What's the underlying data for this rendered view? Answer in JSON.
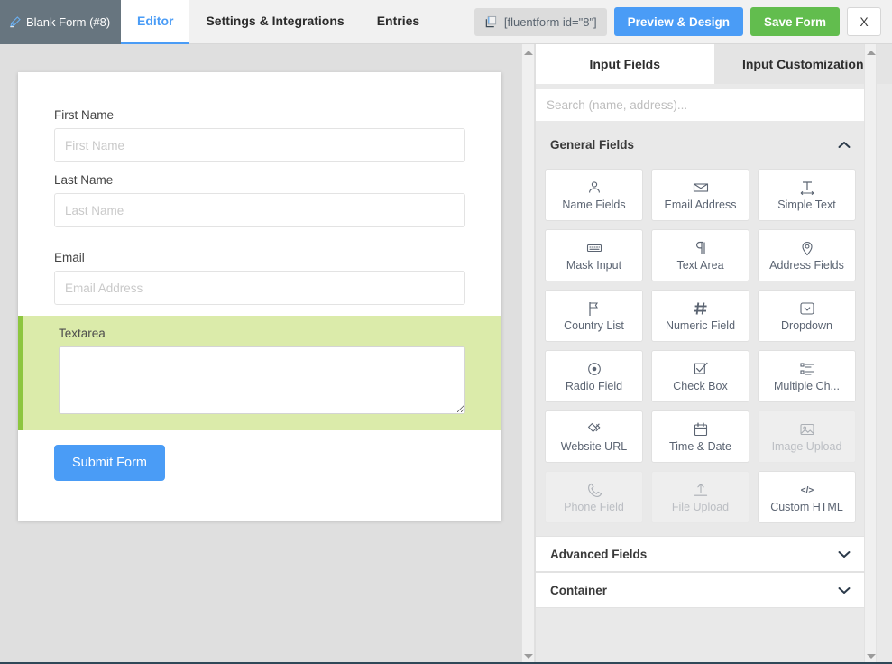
{
  "header": {
    "form_title": "Blank Form (#8)",
    "pencil_icon": "pencil-icon",
    "tabs": [
      {
        "label": "Editor",
        "active": true
      },
      {
        "label": "Settings & Integrations",
        "active": false
      },
      {
        "label": "Entries",
        "active": false
      }
    ],
    "shortcode": "[fluentform id=\"8\"]",
    "shortcode_icon": "copy-icon",
    "preview_label": "Preview & Design",
    "save_label": "Save Form",
    "close_label": "X",
    "colors": {
      "title_tab_bg": "#67757f",
      "accent_blue": "#4a9cf6",
      "save_green": "#62bd4e",
      "header_bg": "#f1f1f1"
    }
  },
  "form": {
    "fields": [
      {
        "label": "First Name",
        "placeholder": "First Name",
        "value": "",
        "type": "text",
        "highlighted": false
      },
      {
        "label": "Last Name",
        "placeholder": "Last Name",
        "value": "",
        "type": "text",
        "highlighted": false
      },
      {
        "label": "Email",
        "placeholder": "Email Address",
        "value": "",
        "type": "text",
        "highlighted": false
      }
    ],
    "textarea": {
      "label": "Textarea",
      "placeholder": "",
      "value": "",
      "highlighted": true,
      "highlight_bg": "#dbebaa",
      "highlight_border": "#8dc63f"
    },
    "submit_label": "Submit Form"
  },
  "panel": {
    "tabs": [
      {
        "label": "Input Fields",
        "active": true
      },
      {
        "label": "Input Customization",
        "active": false
      }
    ],
    "search": {
      "placeholder": "Search (name, address)...",
      "value": "",
      "icon": "search-icon"
    },
    "sections": [
      {
        "label": "General Fields",
        "expanded": true,
        "chevron": "chevron-up-icon"
      },
      {
        "label": "Advanced Fields",
        "expanded": false,
        "chevron": "chevron-down-icon"
      },
      {
        "label": "Container",
        "expanded": false,
        "chevron": "chevron-down-icon"
      }
    ],
    "general_fields": [
      {
        "label": "Name Fields",
        "icon": "user-icon",
        "disabled": false
      },
      {
        "label": "Email Address",
        "icon": "envelope-icon",
        "disabled": false
      },
      {
        "label": "Simple Text",
        "icon": "text-width-icon",
        "disabled": false
      },
      {
        "label": "Mask Input",
        "icon": "keyboard-icon",
        "disabled": false
      },
      {
        "label": "Text Area",
        "icon": "pilcrow-icon",
        "disabled": false
      },
      {
        "label": "Address Fields",
        "icon": "map-pin-icon",
        "disabled": false
      },
      {
        "label": "Country List",
        "icon": "flag-icon",
        "disabled": false
      },
      {
        "label": "Numeric Field",
        "icon": "hash-icon",
        "disabled": false
      },
      {
        "label": "Dropdown",
        "icon": "dropdown-icon",
        "disabled": false
      },
      {
        "label": "Radio Field",
        "icon": "radio-icon",
        "disabled": false
      },
      {
        "label": "Check Box",
        "icon": "checkbox-icon",
        "disabled": false
      },
      {
        "label": "Multiple Ch...",
        "icon": "list-icon",
        "disabled": false
      },
      {
        "label": "Website URL",
        "icon": "link-icon",
        "disabled": false
      },
      {
        "label": "Time & Date",
        "icon": "calendar-icon",
        "disabled": false
      },
      {
        "label": "Image Upload",
        "icon": "image-icon",
        "disabled": true
      },
      {
        "label": "Phone Field",
        "icon": "phone-icon",
        "disabled": true
      },
      {
        "label": "File Upload",
        "icon": "upload-icon",
        "disabled": true
      },
      {
        "label": "Custom HTML",
        "icon": "code-icon",
        "disabled": false
      }
    ]
  }
}
